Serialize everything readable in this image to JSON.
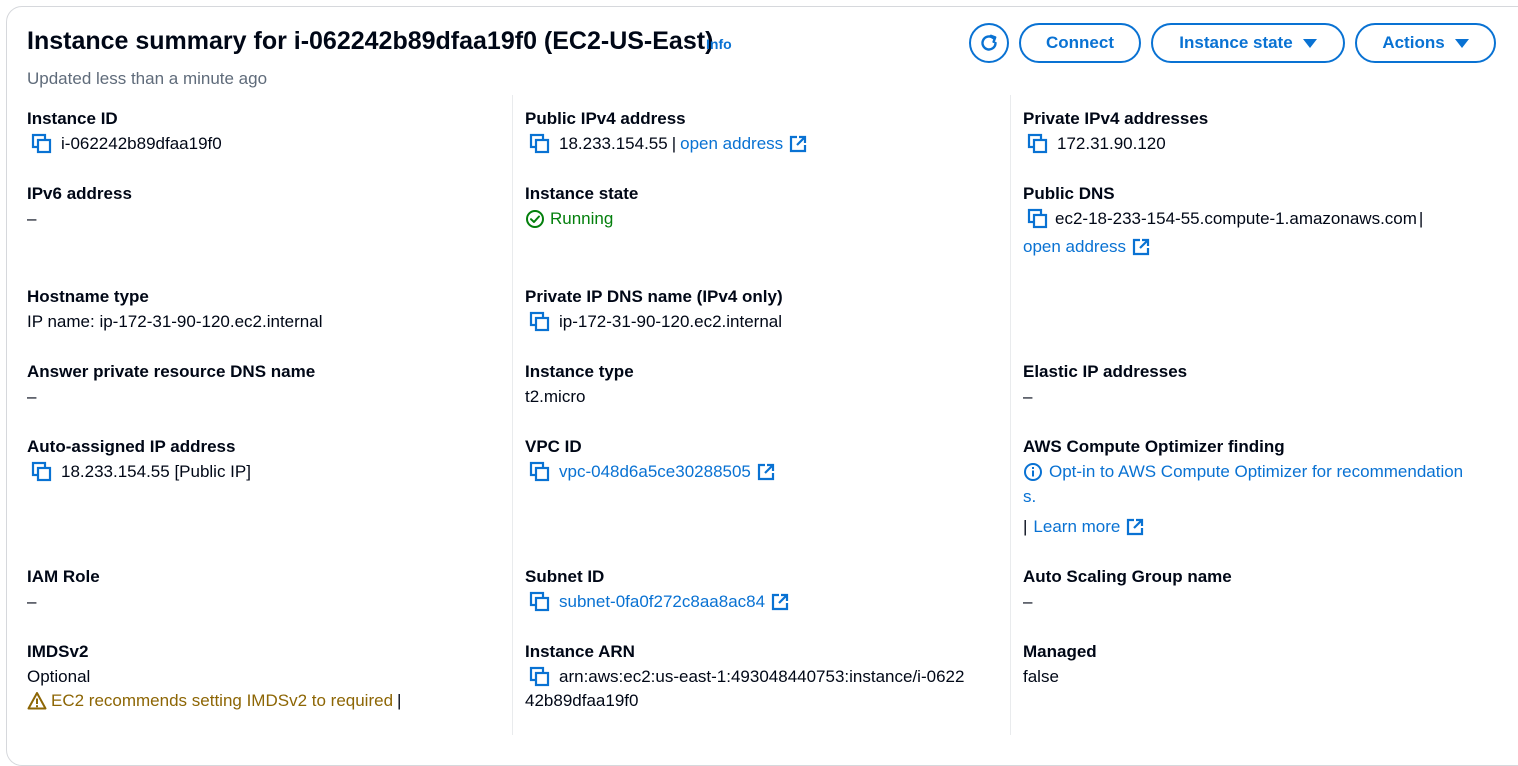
{
  "header": {
    "title": "Instance summary for i-062242b89dfaa19f0 (EC2-US-East)",
    "info_link": "Info",
    "updated": "Updated less than a minute ago",
    "connect_label": "Connect",
    "instance_state_label": "Instance state",
    "actions_label": "Actions"
  },
  "fields": {
    "instance_id": {
      "label": "Instance ID",
      "value": "i-062242b89dfaa19f0"
    },
    "public_ipv4": {
      "label": "Public IPv4 address",
      "value": "18.233.154.55",
      "link": "open address"
    },
    "private_ipv4": {
      "label": "Private IPv4 addresses",
      "value": "172.31.90.120"
    },
    "ipv6": {
      "label": "IPv6 address",
      "value": "–"
    },
    "instance_state": {
      "label": "Instance state",
      "value": "Running"
    },
    "public_dns": {
      "label": "Public DNS",
      "value": "ec2-18-233-154-55.compute-1.amazonaws.com",
      "link": "open address"
    },
    "hostname_type": {
      "label": "Hostname type",
      "value": "IP name: ip-172-31-90-120.ec2.internal"
    },
    "private_ip_dns": {
      "label": "Private IP DNS name (IPv4 only)",
      "value": "ip-172-31-90-120.ec2.internal"
    },
    "answer_dns": {
      "label": "Answer private resource DNS name",
      "value": "–"
    },
    "instance_type": {
      "label": "Instance type",
      "value": "t2.micro"
    },
    "elastic_ip": {
      "label": "Elastic IP addresses",
      "value": "–"
    },
    "auto_ip": {
      "label": "Auto-assigned IP address",
      "value": "18.233.154.55 [Public IP]"
    },
    "vpc_id": {
      "label": "VPC ID",
      "value": "vpc-048d6a5ce30288505"
    },
    "optimizer": {
      "label": "AWS Compute Optimizer finding",
      "line1": "Opt-in to AWS Compute Optimizer for recommendation",
      "line2": "s.",
      "learn_more": "Learn more"
    },
    "iam_role": {
      "label": "IAM Role",
      "value": "–"
    },
    "subnet_id": {
      "label": "Subnet ID",
      "value": "subnet-0fa0f272c8aa8ac84"
    },
    "asg_name": {
      "label": "Auto Scaling Group name",
      "value": "–"
    },
    "imdsv2": {
      "label": "IMDSv2",
      "value": "Optional",
      "warning": "EC2 recommends setting IMDSv2 to required"
    },
    "instance_arn": {
      "label": "Instance ARN",
      "line1": "arn:aws:ec2:us-east-1:493048440753:instance/i-0622",
      "line2": "42b89dfaa19f0"
    },
    "managed": {
      "label": "Managed",
      "value": "false"
    }
  },
  "colors": {
    "link": "#0972d3",
    "success": "#037f0c",
    "warning": "#8d6605",
    "text": "#000716",
    "muted": "#5f6b7a"
  },
  "icons": [
    "refresh-icon",
    "caret-down-icon",
    "copy-icon",
    "external-link-icon",
    "check-circle-icon",
    "info-circle-icon",
    "warning-icon"
  ]
}
